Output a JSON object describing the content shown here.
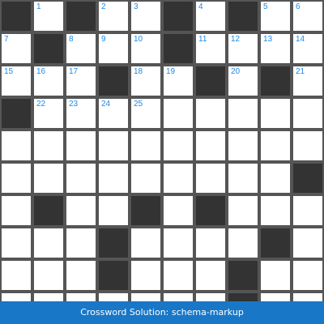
{
  "puzzle": {
    "columns": 10,
    "rows": [
      [
        "#",
        "1",
        "#",
        "2",
        "3",
        "#",
        "4",
        "#",
        "5",
        "6"
      ],
      [
        "7",
        "#",
        "8",
        "9",
        "10",
        "#",
        "11",
        "12",
        "13",
        "14"
      ],
      [
        "15",
        "16",
        "17",
        "#",
        "18",
        "19",
        "#",
        "20",
        "#",
        "21"
      ],
      [
        "#",
        "22",
        "23",
        "24",
        "25",
        "",
        "",
        "",
        "",
        ""
      ],
      [
        "",
        "",
        "",
        "",
        "",
        "",
        "",
        "",
        "",
        ""
      ],
      [
        "",
        "",
        "",
        "",
        "",
        "",
        "",
        "",
        "",
        "#"
      ],
      [
        "",
        "#",
        "",
        "",
        "#",
        "",
        "#",
        "",
        "",
        ""
      ],
      [
        "",
        "",
        "",
        "#",
        "",
        "",
        "",
        "",
        "#",
        ""
      ],
      [
        "",
        "",
        "",
        "#",
        "",
        "",
        "",
        "#",
        "",
        ""
      ],
      [
        "",
        "",
        "",
        "",
        "",
        "",
        "",
        "#",
        "",
        ""
      ]
    ]
  },
  "footer": {
    "title": "Crossword Solution: schema-markup"
  },
  "colors": {
    "black_cell": "#333333",
    "grid_line": "#555555",
    "number": "#1e88e5",
    "footer_bg": "#1877c7"
  }
}
